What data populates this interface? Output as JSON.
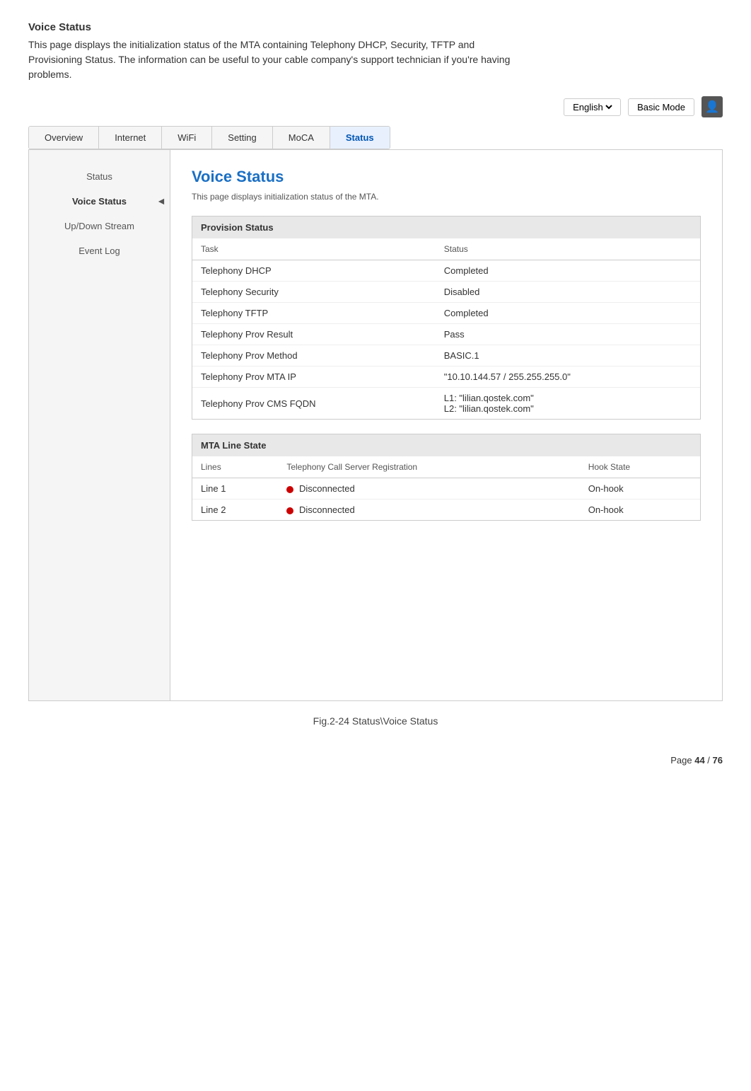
{
  "heading": {
    "title": "Voice Status",
    "description": "This page displays the initialization status of the MTA containing Telephony DHCP, Security, TFTP and Provisioning Status. The information can be useful to your cable company's support   technician if you're having problems."
  },
  "topbar": {
    "language": "English",
    "language_options": [
      "English"
    ],
    "basic_mode_label": "Basic Mode"
  },
  "nav": {
    "tabs": [
      {
        "label": "Overview",
        "active": false
      },
      {
        "label": "Internet",
        "active": false
      },
      {
        "label": "WiFi",
        "active": false
      },
      {
        "label": "Setting",
        "active": false
      },
      {
        "label": "MoCA",
        "active": false
      },
      {
        "label": "Status",
        "active": true
      }
    ]
  },
  "sidebar": {
    "items": [
      {
        "label": "Status",
        "active": false
      },
      {
        "label": "Voice Status",
        "active": true
      },
      {
        "label": "Up/Down Stream",
        "active": false
      },
      {
        "label": "Event Log",
        "active": false
      }
    ]
  },
  "content": {
    "title": "Voice Status",
    "subtitle": "This page displays initialization status of the MTA.",
    "provision_status": {
      "header": "Provision Status",
      "columns": [
        "Task",
        "Status"
      ],
      "rows": [
        {
          "task": "Telephony DHCP",
          "status": "Completed"
        },
        {
          "task": "Telephony Security",
          "status": "Disabled"
        },
        {
          "task": "Telephony TFTP",
          "status": "Completed"
        },
        {
          "task": "Telephony Prov Result",
          "status": "Pass"
        },
        {
          "task": "Telephony Prov Method",
          "status": "BASIC.1"
        },
        {
          "task": "Telephony Prov MTA IP",
          "status": "\"10.10.144.57 / 255.255.255.0\""
        },
        {
          "task": "Telephony Prov CMS FQDN",
          "status_line1": "L1: \"lilian.qostek.com\"",
          "status_line2": "L2: \"lilian.qostek.com\""
        }
      ]
    },
    "mta_line_state": {
      "header": "MTA Line State",
      "columns": [
        "Lines",
        "Telephony Call Server Registration",
        "Hook State"
      ],
      "rows": [
        {
          "line": "Line 1",
          "registration": "Disconnected",
          "hook_state": "On-hook"
        },
        {
          "line": "Line 2",
          "registration": "Disconnected",
          "hook_state": "On-hook"
        }
      ]
    }
  },
  "figure_caption": "Fig.2-24 Status\\Voice Status",
  "page_number": {
    "prefix": "Page ",
    "current": "44",
    "separator": " / ",
    "total": "76"
  }
}
